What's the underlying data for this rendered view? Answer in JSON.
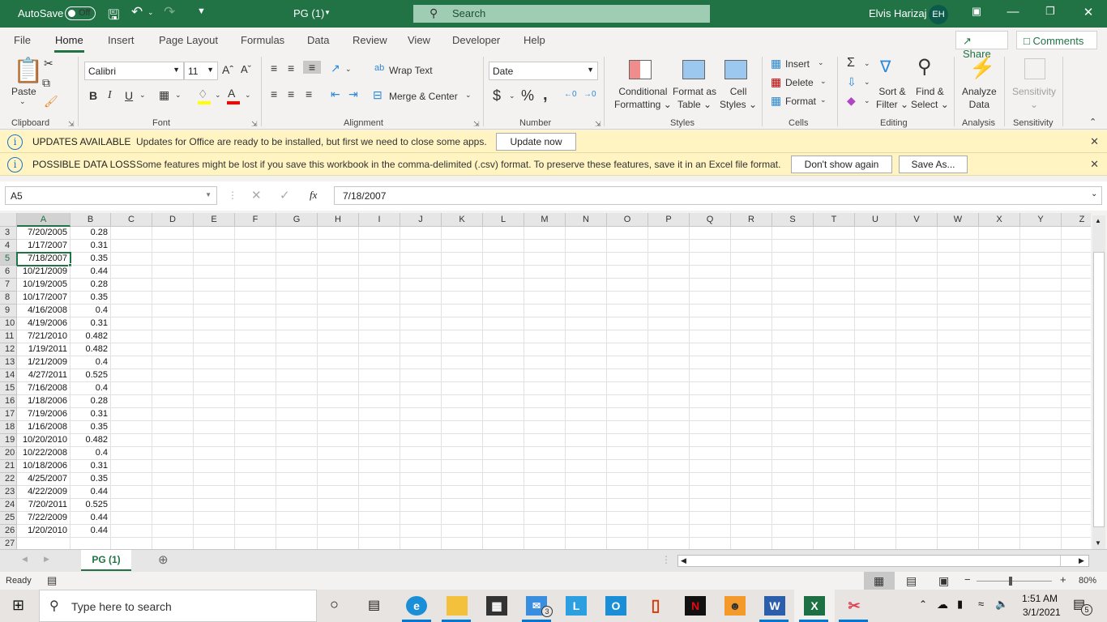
{
  "titlebar": {
    "autosave_label": "AutoSave",
    "autosave_state": "Off",
    "file_name": "PG (1)",
    "search_placeholder": "Search",
    "user_name": "Elvis Harizaj",
    "user_initials": "EH"
  },
  "tabs": [
    "File",
    "Home",
    "Insert",
    "Page Layout",
    "Formulas",
    "Data",
    "Review",
    "View",
    "Developer",
    "Help"
  ],
  "active_tab": "Home",
  "share_label": "Share",
  "comments_label": "Comments",
  "ribbon": {
    "clipboard": {
      "paste": "Paste",
      "group": "Clipboard"
    },
    "font": {
      "name": "Calibri",
      "size": "11",
      "group": "Font",
      "bold": "B",
      "italic": "I",
      "underline": "U",
      "highlight_color": "#ffff00",
      "font_color": "#ff0000"
    },
    "alignment": {
      "wrap_text": "Wrap Text",
      "merge_center": "Merge & Center",
      "group": "Alignment"
    },
    "number": {
      "format": "Date",
      "currency": "$",
      "percent": "%",
      "comma": ",",
      "group": "Number"
    },
    "styles": {
      "conditional": "Conditional",
      "conditional2": "Formatting",
      "format_table": "Format as",
      "format_table2": "Table",
      "cell_styles": "Cell",
      "cell_styles2": "Styles",
      "group": "Styles"
    },
    "cells": {
      "insert": "Insert",
      "delete": "Delete",
      "format": "Format",
      "group": "Cells"
    },
    "editing": {
      "sort": "Sort &",
      "sort2": "Filter",
      "find": "Find &",
      "find2": "Select",
      "group": "Editing"
    },
    "analysis": {
      "analyze": "Analyze",
      "analyze2": "Data",
      "group": "Analysis"
    },
    "sensitivity": {
      "label": "Sensitivity",
      "group": "Sensitivity"
    }
  },
  "messages": [
    {
      "title": "UPDATES AVAILABLE",
      "body": "Updates for Office are ready to be installed, but first we need to close some apps.",
      "buttons": [
        "Update now"
      ]
    },
    {
      "title": "POSSIBLE DATA LOSS",
      "body": "Some features might be lost if you save this workbook in the comma-delimited (.csv) format. To preserve these features, save it in an Excel file format.",
      "buttons": [
        "Don't show again",
        "Save As..."
      ]
    }
  ],
  "formula_bar": {
    "name_box": "A5",
    "formula": "7/18/2007",
    "fx": "fx"
  },
  "columns": [
    "A",
    "B",
    "C",
    "D",
    "E",
    "F",
    "G",
    "H",
    "I",
    "J",
    "K",
    "L",
    "M",
    "N",
    "O",
    "P",
    "Q",
    "R",
    "S",
    "T",
    "U",
    "V",
    "W",
    "X",
    "Y",
    "Z"
  ],
  "selected_cell": "A5",
  "rows": [
    {
      "n": "3",
      "a": "7/20/2005",
      "b": "0.28"
    },
    {
      "n": "4",
      "a": "1/17/2007",
      "b": "0.31"
    },
    {
      "n": "5",
      "a": "7/18/2007",
      "b": "0.35"
    },
    {
      "n": "6",
      "a": "10/21/2009",
      "b": "0.44"
    },
    {
      "n": "7",
      "a": "10/19/2005",
      "b": "0.28"
    },
    {
      "n": "8",
      "a": "10/17/2007",
      "b": "0.35"
    },
    {
      "n": "9",
      "a": "4/16/2008",
      "b": "0.4"
    },
    {
      "n": "10",
      "a": "4/19/2006",
      "b": "0.31"
    },
    {
      "n": "11",
      "a": "7/21/2010",
      "b": "0.482"
    },
    {
      "n": "12",
      "a": "1/19/2011",
      "b": "0.482"
    },
    {
      "n": "13",
      "a": "1/21/2009",
      "b": "0.4"
    },
    {
      "n": "14",
      "a": "4/27/2011",
      "b": "0.525"
    },
    {
      "n": "15",
      "a": "7/16/2008",
      "b": "0.4"
    },
    {
      "n": "16",
      "a": "1/18/2006",
      "b": "0.28"
    },
    {
      "n": "17",
      "a": "7/19/2006",
      "b": "0.31"
    },
    {
      "n": "18",
      "a": "1/16/2008",
      "b": "0.35"
    },
    {
      "n": "19",
      "a": "10/20/2010",
      "b": "0.482"
    },
    {
      "n": "20",
      "a": "10/22/2008",
      "b": "0.4"
    },
    {
      "n": "21",
      "a": "10/18/2006",
      "b": "0.31"
    },
    {
      "n": "22",
      "a": "4/25/2007",
      "b": "0.35"
    },
    {
      "n": "23",
      "a": "4/22/2009",
      "b": "0.44"
    },
    {
      "n": "24",
      "a": "7/20/2011",
      "b": "0.525"
    },
    {
      "n": "25",
      "a": "7/22/2009",
      "b": "0.44"
    },
    {
      "n": "26",
      "a": "1/20/2010",
      "b": "0.44"
    },
    {
      "n": "27",
      "a": "",
      "b": ""
    }
  ],
  "sheet_tab": "PG (1)",
  "status": {
    "ready": "Ready",
    "zoom": "80%",
    "zoom_fraction": 0.45
  },
  "taskbar": {
    "search_placeholder": "Type here to search",
    "mail_badge": "3",
    "time": "1:51 AM",
    "date": "3/1/2021",
    "notification_badge": "5"
  }
}
